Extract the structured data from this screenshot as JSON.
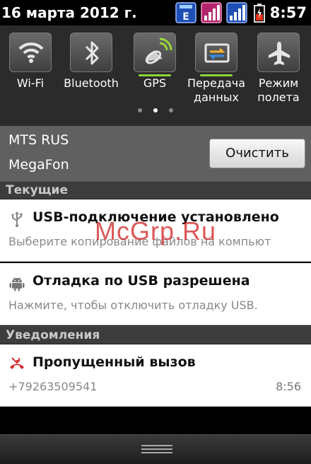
{
  "status_bar": {
    "date": "16 марта 2012 г.",
    "network_type": "E",
    "time": "8:57",
    "icons": [
      "network-type-icon",
      "signal-sim1-icon",
      "signal-sim2-icon",
      "battery-icon"
    ]
  },
  "quick_settings": {
    "toggles": [
      {
        "label": "Wi-Fi",
        "icon": "wifi-icon",
        "active": false
      },
      {
        "label": "Bluetooth",
        "icon": "bluetooth-icon",
        "active": false
      },
      {
        "label": "GPS",
        "icon": "gps-icon",
        "active": true
      },
      {
        "label": "Передача данных",
        "icon": "data-transfer-icon",
        "active": true
      },
      {
        "label": "Режим полета",
        "icon": "airplane-icon",
        "active": false
      }
    ],
    "page_count": 3,
    "active_page": 2
  },
  "carriers": {
    "line1": "MTS RUS",
    "line2": "MegaFon",
    "clear_label": "Очистить"
  },
  "sections": {
    "ongoing": "Текущие",
    "notifications": "Уведомления"
  },
  "notifications": [
    {
      "title": "USB-подключение установлено",
      "text": "Выберите копирование файлов на компьют",
      "icon": "usb-icon"
    },
    {
      "title": "Отладка по USB разрешена",
      "text": "Нажмите, чтобы отключить отладку USB.",
      "icon": "android-icon"
    },
    {
      "title": "Пропущенный вызов",
      "text": "+79263509541",
      "time": "8:56",
      "icon": "missed-call-icon"
    }
  ],
  "watermark": "McGrp.Ru",
  "colors": {
    "active_bar": "#8bd63a",
    "watermark": "#c80000",
    "missed_call": "#d32f2f"
  }
}
